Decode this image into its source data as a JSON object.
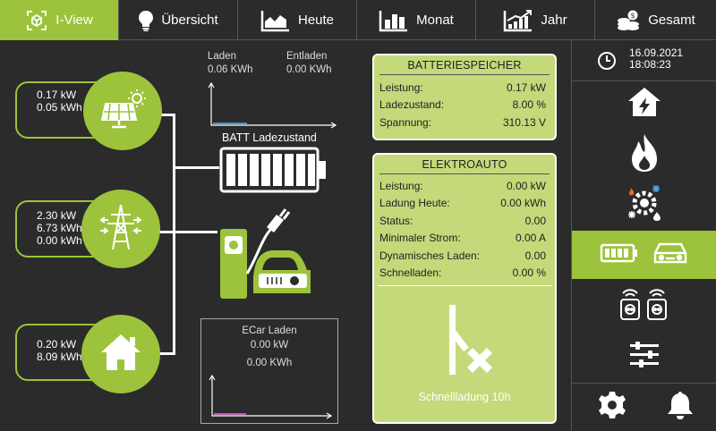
{
  "nav": {
    "tabs": [
      {
        "label": "I-View",
        "icon": "network-icon"
      },
      {
        "label": "Übersicht",
        "icon": "lightbulb-icon"
      },
      {
        "label": "Heute",
        "icon": "area-chart-icon"
      },
      {
        "label": "Monat",
        "icon": "bar-chart-icon"
      },
      {
        "label": "Jahr",
        "icon": "trend-chart-icon"
      },
      {
        "label": "Gesamt",
        "icon": "coins-icon"
      }
    ],
    "active": "I-View"
  },
  "clock": {
    "date": "16.09.2021",
    "time": "18:08:23"
  },
  "pv": {
    "power": "0.17 kW",
    "energy": "0.05 kWh"
  },
  "grid": {
    "power": "2.30 kW",
    "import": "6.73 kWh",
    "export": "0.00 kWh"
  },
  "house": {
    "power": "0.20 kW",
    "energy": "8.09 kWh"
  },
  "battery_chart": {
    "laden_label": "Laden",
    "laden_value": "0.06 KWh",
    "entladen_label": "Entladen",
    "entladen_value": "0.00 KWh",
    "caption": "BATT Ladezustand"
  },
  "ecar_chart": {
    "title": "ECar Laden",
    "power": "0.00 kW",
    "energy": "0.00 KWh"
  },
  "battery_card": {
    "title": "BATTERIESPEICHER",
    "rows": [
      {
        "label": "Leistung:",
        "value": "0.17 kW"
      },
      {
        "label": "Ladezustand:",
        "value": "8.00 %"
      },
      {
        "label": "Spannung:",
        "value": "310.13 V"
      }
    ]
  },
  "ecar_card": {
    "title": "ELEKTROAUTO",
    "rows": [
      {
        "label": "Leistung:",
        "value": "0.00 kW"
      },
      {
        "label": "Ladung Heute:",
        "value": "0.00 kWh"
      },
      {
        "label": "Status:",
        "value": "0.00"
      },
      {
        "label": "Minimaler Strom:",
        "value": "0.00 A"
      },
      {
        "label": "Dynamisches Laden:",
        "value": "0.00"
      },
      {
        "label": "Schnelladen:",
        "value": "0.00 %"
      }
    ],
    "footer": "Schnellladung 10h"
  },
  "colors": {
    "accent": "#9cc33b",
    "card": "#c4d97a",
    "background": "#2b2b2b",
    "laden_bar": "#4a90c8",
    "ecar_bar": "#c05ab0"
  }
}
